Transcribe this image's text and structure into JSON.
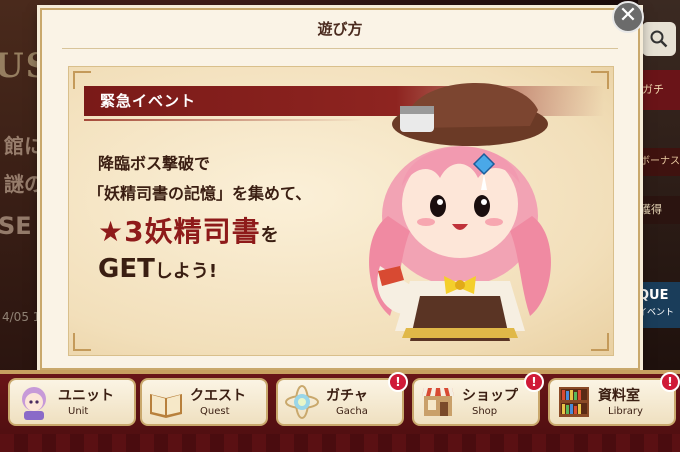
{
  "background": {
    "left_title_fragment": "US",
    "left_text_1": "館に",
    "left_text_2": "謎の",
    "left_text_3": "SE",
    "left_date": "4/05 1",
    "right_gacha_fragment": "ガチ",
    "right_bonus_fragment": "ボーナス",
    "right_kakutoku_fragment": "獲得",
    "right_quest_fragment": "QUE",
    "right_quest_sub": "イベント"
  },
  "dialog": {
    "title": "遊び方",
    "close_symbol": "✕",
    "banner": "緊急イベント",
    "line1": "降臨ボス撃破で",
    "line2": "「妖精司書の記憶」を集めて、",
    "line3_main": "★3妖精司書",
    "line3_suffix": "を",
    "line4_main": "GET",
    "line4_suffix": "しよう!"
  },
  "nav": {
    "items": [
      {
        "jp": "ユニット",
        "en": "Unit",
        "icon": "unit-avatar-icon",
        "badge": ""
      },
      {
        "jp": "クエスト",
        "en": "Quest",
        "icon": "book-icon",
        "badge": ""
      },
      {
        "jp": "ガチャ",
        "en": "Gacha",
        "icon": "gacha-orb-icon",
        "badge": "!"
      },
      {
        "jp": "ショップ",
        "en": "Shop",
        "icon": "shop-icon",
        "badge": "!"
      },
      {
        "jp": "資料室",
        "en": "Library",
        "icon": "bookshelf-icon",
        "badge": "!"
      }
    ]
  },
  "colors": {
    "accent_red": "#8e1a1a",
    "banner_red": "#7a1a18",
    "badge": "#d01a38",
    "parchment": "#f2dfba"
  }
}
